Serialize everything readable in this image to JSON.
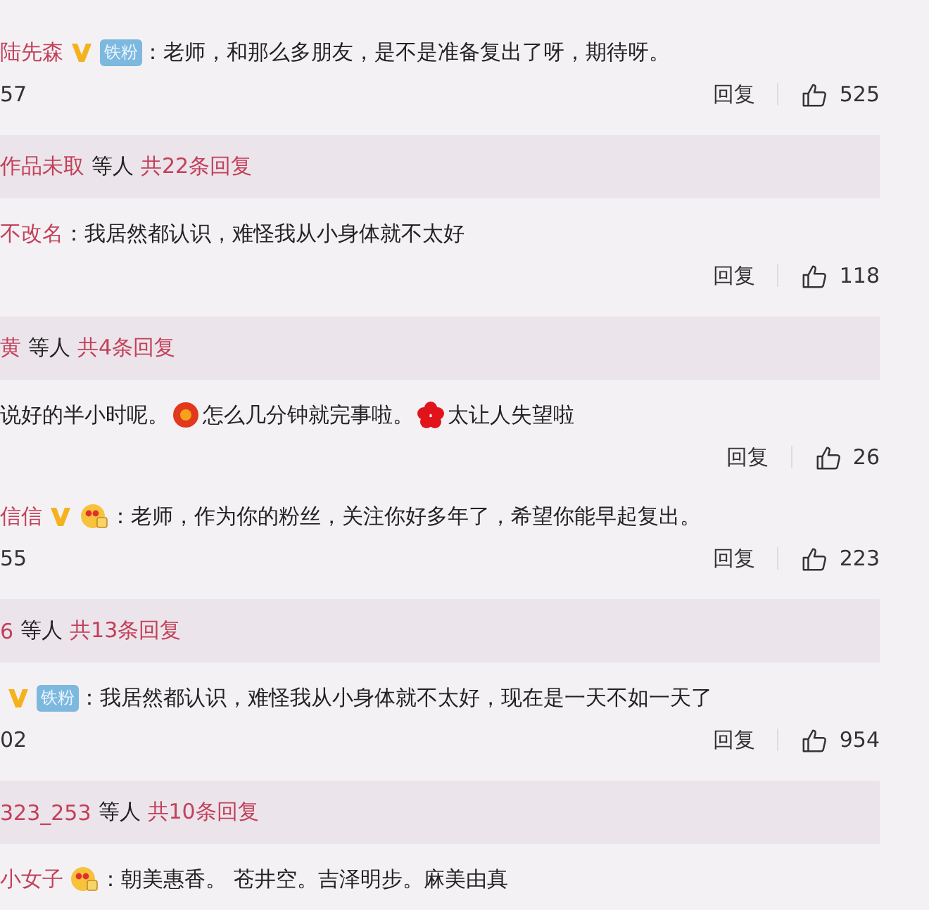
{
  "items": [
    {
      "kind": "comment",
      "name": "陆先森",
      "verified": true,
      "badge": {
        "kind": "fan",
        "text": "铁粉"
      },
      "parts": [
        {
          "kind": "text",
          "text": "：老师，和那么多朋友，是不是准备复出了呀，期待呀。"
        }
      ],
      "time": "57",
      "reply": "回复",
      "likes": "525"
    },
    {
      "kind": "replies",
      "names": "作品未取",
      "others": "等人",
      "count": "共22条回复"
    },
    {
      "kind": "comment",
      "name": "不改名",
      "verified": false,
      "parts": [
        {
          "kind": "text",
          "text": "：我居然都认识，难怪我从小身体就不太好"
        }
      ],
      "reply": "回复",
      "likes": "118"
    },
    {
      "kind": "replies",
      "names": "黄",
      "others": "等人",
      "count": "共4条回复"
    },
    {
      "kind": "comment",
      "verified": false,
      "parts": [
        {
          "kind": "text",
          "text": "说好的半小时呢。"
        },
        {
          "kind": "lantern"
        },
        {
          "kind": "text",
          "text": "怎么几分钟就完事啦。"
        },
        {
          "kind": "flower"
        },
        {
          "kind": "text",
          "text": "太让人失望啦"
        }
      ],
      "reply": "回复",
      "likes": "26"
    },
    {
      "kind": "comment",
      "name": "信信",
      "verified": true,
      "badge": {
        "kind": "emoji"
      },
      "parts": [
        {
          "kind": "text",
          "text": "：老师，作为你的粉丝，关注你好多年了，希望你能早起复出。"
        }
      ],
      "time": "55",
      "reply": "回复",
      "likes": "223"
    },
    {
      "kind": "replies",
      "names": "6",
      "others": "等人",
      "count": "共13条回复"
    },
    {
      "kind": "comment",
      "verified": true,
      "badge": {
        "kind": "fan",
        "text": "铁粉"
      },
      "parts": [
        {
          "kind": "text",
          "text": "：我居然都认识，难怪我从小身体就不太好，现在是一天不如一天了"
        }
      ],
      "time": "02",
      "reply": "回复",
      "likes": "954"
    },
    {
      "kind": "replies",
      "names": "323_253",
      "others": "等人",
      "count": "共10条回复"
    },
    {
      "kind": "comment",
      "name": "小女子",
      "verified": false,
      "badge": {
        "kind": "emoji"
      },
      "parts": [
        {
          "kind": "text",
          "text": "：朝美惠香。 苍井空。吉泽明步。麻美由真"
        }
      ]
    }
  ]
}
